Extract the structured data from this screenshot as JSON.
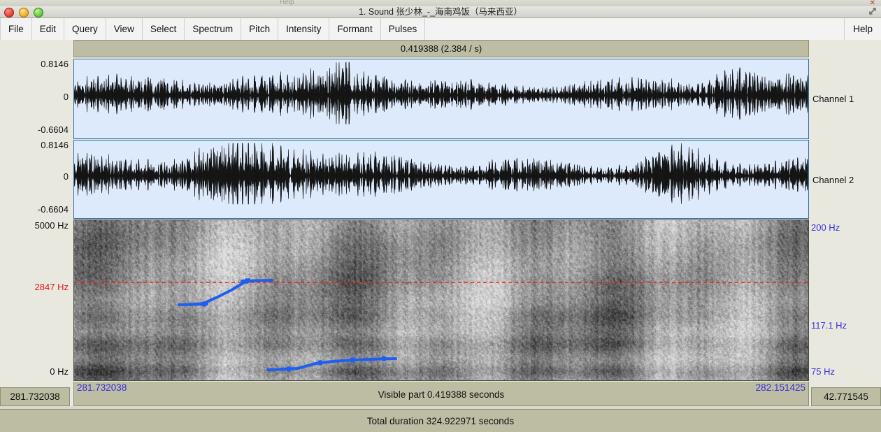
{
  "window": {
    "title": "1. Sound 张少林_-_海南鸡饭（马来西亚）",
    "ghost_title": "Help",
    "traffic_lights": [
      "close-button",
      "minimize-button",
      "zoom-button"
    ],
    "resize_icon": "resize-diagonal-icon"
  },
  "menubar": {
    "items": [
      {
        "label": "File"
      },
      {
        "label": "Edit"
      },
      {
        "label": "Query"
      },
      {
        "label": "View"
      },
      {
        "label": "Select"
      },
      {
        "label": "Spectrum"
      },
      {
        "label": "Pitch"
      },
      {
        "label": "Intensity"
      },
      {
        "label": "Formant"
      },
      {
        "label": "Pulses"
      }
    ],
    "help": "Help"
  },
  "selection_header": {
    "text": "0.419388 (2.384 / s)"
  },
  "channels": [
    {
      "name": "Channel 1",
      "right_label": "Channel 1",
      "y_max": "0.8146",
      "y_zero": "0",
      "y_min": "-0.6604"
    },
    {
      "name": "Channel 2",
      "right_label": "Channel 2",
      "y_max": "0.8146",
      "y_zero": "0",
      "y_min": "-0.6604"
    }
  ],
  "spectrogram": {
    "freq_top": "5000 Hz",
    "freq_bottom": "0 Hz",
    "cursor_freq": "2847 Hz",
    "cursor_freq_color": "#e01b1b",
    "pitch_top": "200 Hz",
    "pitch_cursor": "117.1 Hz",
    "pitch_bottom": "75 Hz",
    "pitch_color": "#3a30d8",
    "track_color": "#1f5ff0"
  },
  "timebar": {
    "start": "281.732038",
    "end": "282.151425",
    "visible_part": "Visible part 0.419388 seconds"
  },
  "corners": {
    "left_value": "281.732038",
    "right_value": "42.771545"
  },
  "total_bar": {
    "text": "Total duration 324.922971 seconds"
  }
}
